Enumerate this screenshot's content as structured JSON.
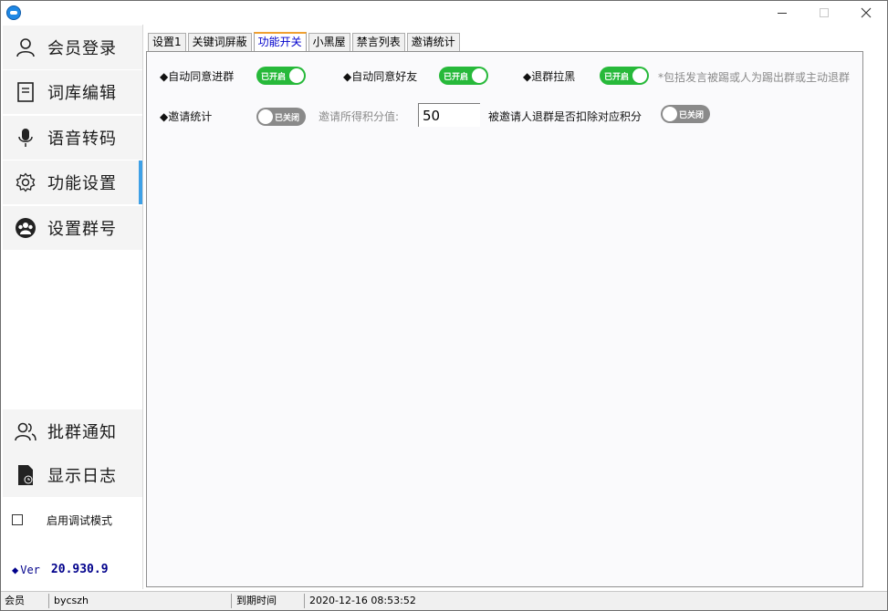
{
  "window": {
    "title": ""
  },
  "sidebar": {
    "items": [
      {
        "id": "login",
        "label": "会员登录",
        "icon": "user-icon"
      },
      {
        "id": "dict",
        "label": "词库编辑",
        "icon": "document-icon"
      },
      {
        "id": "voice",
        "label": "语音转码",
        "icon": "microphone-icon"
      },
      {
        "id": "settings",
        "label": "功能设置",
        "icon": "gear-icon",
        "active": true
      },
      {
        "id": "group",
        "label": "设置群号",
        "icon": "group-icon"
      }
    ],
    "bottom_items": [
      {
        "id": "notify",
        "label": "批群通知",
        "icon": "users-icon"
      },
      {
        "id": "log",
        "label": "显示日志",
        "icon": "log-icon"
      }
    ],
    "debug_mode_label": "启用调试模式",
    "debug_mode_checked": false,
    "version_label": "Ver",
    "version_number": "20.930.9",
    "active_color": "#3ea0e6"
  },
  "tabs": [
    {
      "label": "设置1",
      "active": false
    },
    {
      "label": "关键词屏蔽",
      "active": false
    },
    {
      "label": "功能开关",
      "active": true
    },
    {
      "label": "小黑屋",
      "active": false
    },
    {
      "label": "禁言列表",
      "active": false
    },
    {
      "label": "邀请统计",
      "active": false
    }
  ],
  "options": {
    "auto_join_group": {
      "label": "◆自动同意进群",
      "state": "已开启",
      "on": true
    },
    "auto_add_friend": {
      "label": "◆自动同意好友",
      "state": "已开启",
      "on": true
    },
    "leave_blacklist": {
      "label": "◆退群拉黑",
      "state": "已开启",
      "on": true
    },
    "leave_note": "*包括发言被踢或人为踢出群或主动退群",
    "invite_stats": {
      "label": "◆邀请统计",
      "state": "已关闭",
      "on": false
    },
    "invite_points_label": "邀请所得积分值:",
    "invite_points_value": "50",
    "deduct_label": "被邀请人退群是否扣除对应积分",
    "deduct_toggle": {
      "state": "已关闭",
      "on": false
    }
  },
  "statusbar": {
    "member_label": "会员",
    "member_value": "bycszh",
    "expire_label": "到期时间",
    "expire_value": "2020-12-16 08:53:52"
  },
  "colors": {
    "toggle_on": "#27b93a",
    "toggle_off": "#8a8a8a",
    "version_text": "#00008b",
    "active_tab_text": "#0000cc"
  }
}
